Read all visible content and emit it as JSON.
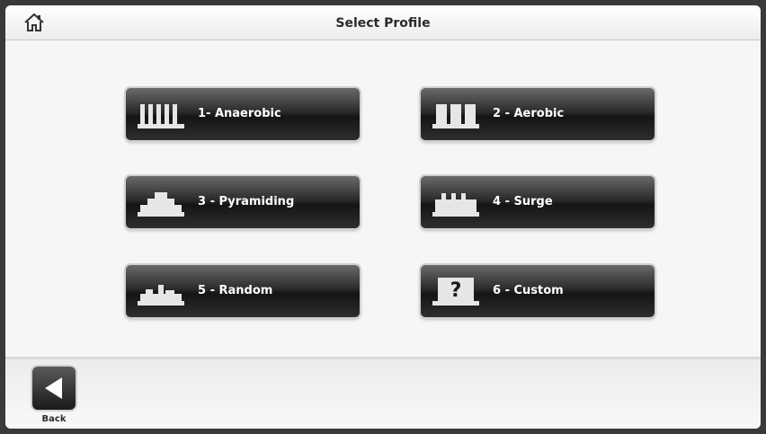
{
  "header": {
    "title": "Select Profile",
    "home_icon": "home-icon"
  },
  "profiles": [
    {
      "label": "1- Anaerobic",
      "icon": "anaerobic-profile-icon"
    },
    {
      "label": "2 - Aerobic",
      "icon": "aerobic-profile-icon"
    },
    {
      "label": "3 - Pyramiding",
      "icon": "pyramiding-profile-icon"
    },
    {
      "label": "4 - Surge",
      "icon": "surge-profile-icon"
    },
    {
      "label": "5 - Random",
      "icon": "random-profile-icon"
    },
    {
      "label": "6 - Custom",
      "icon": "custom-profile-icon"
    }
  ],
  "footer": {
    "back_label": "Back",
    "back_icon": "back-arrow-icon"
  },
  "colors": {
    "button_dark": "#1a1a1a",
    "icon_light": "#e6e6e6",
    "background": "#f4f4f4"
  }
}
